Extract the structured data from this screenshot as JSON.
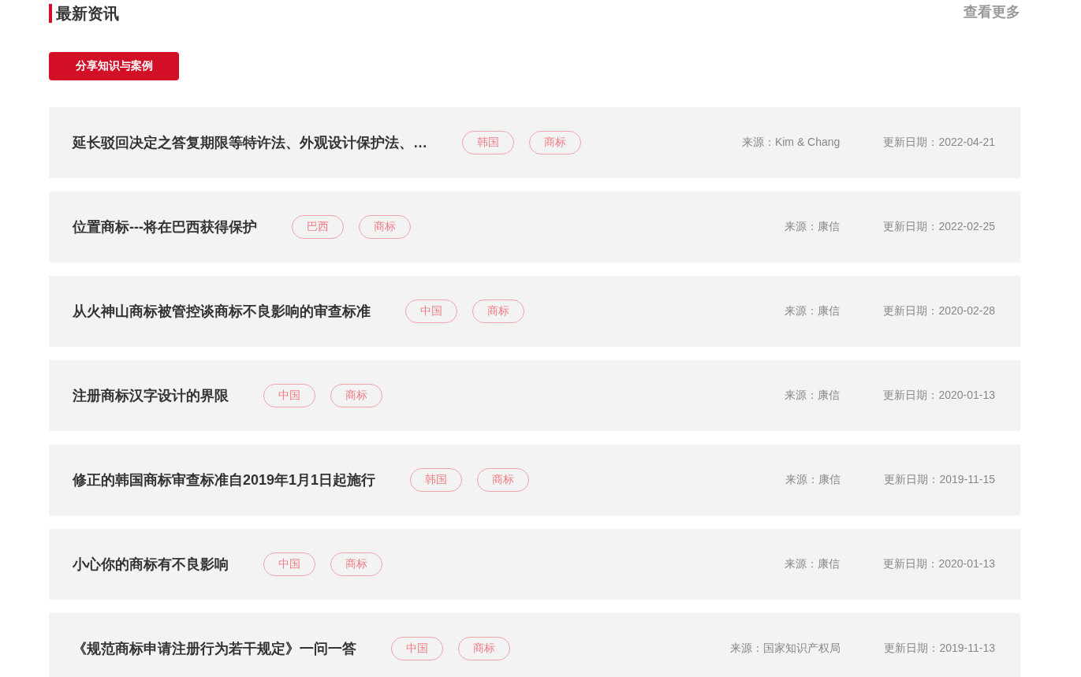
{
  "section": {
    "title": "最新资讯",
    "more_link": "查看更多"
  },
  "share_button": "分享知识与案例",
  "articles": [
    {
      "title": "延长驳回决定之答复期限等特许法、外观设计保护法、…",
      "tags": [
        "韩国",
        "商标"
      ],
      "source": "来源：Kim & Chang",
      "date": "更新日期：2022-04-21"
    },
    {
      "title": "位置商标---将在巴西获得保护",
      "tags": [
        "巴西",
        "商标"
      ],
      "source": "来源：康信",
      "date": "更新日期：2022-02-25"
    },
    {
      "title": "从火神山商标被管控谈商标不良影响的审查标准",
      "tags": [
        "中国",
        "商标"
      ],
      "source": "来源：康信",
      "date": "更新日期：2020-02-28"
    },
    {
      "title": "注册商标汉字设计的界限",
      "tags": [
        "中国",
        "商标"
      ],
      "source": "来源：康信",
      "date": "更新日期：2020-01-13"
    },
    {
      "title": "修正的韩国商标审查标准自2019年1月1日起施行",
      "tags": [
        "韩国",
        "商标"
      ],
      "source": "来源：康信",
      "date": "更新日期：2019-11-15"
    },
    {
      "title": "小心你的商标有不良影响",
      "tags": [
        "中国",
        "商标"
      ],
      "source": "来源：康信",
      "date": "更新日期：2020-01-13"
    },
    {
      "title": "《规范商标申请注册行为若干规定》一问一答",
      "tags": [
        "中国",
        "商标"
      ],
      "source": "来源：国家知识产权局",
      "date": "更新日期：2019-11-13"
    }
  ]
}
